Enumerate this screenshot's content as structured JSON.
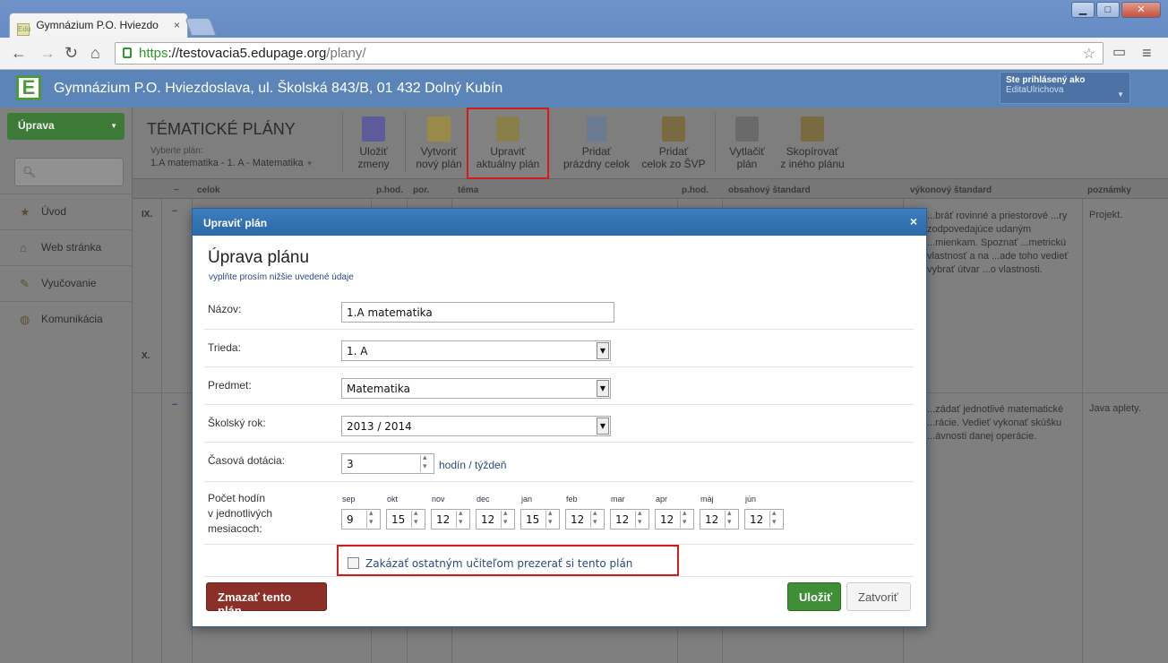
{
  "browser": {
    "tab_title": "Gymnázium P.O. Hviezdo",
    "tab_favicon": "Edu",
    "url_https": "https",
    "url_host": "://testovacia5.edupage.org",
    "url_path": "/plany/"
  },
  "header": {
    "school_name": "Gymnázium P.O. Hviezdoslava, ul. Školská 843/B, 01 432 Dolný Kubín",
    "login_title": "Ste prihlásený ako",
    "login_user": "EditaUlrichova"
  },
  "sidebar": {
    "menu_button": "Úprava",
    "items": [
      {
        "label": "Úvod",
        "icon": "star-icon"
      },
      {
        "label": "Web stránka",
        "icon": "home-icon"
      },
      {
        "label": "Vyučovanie",
        "icon": "book-icon"
      },
      {
        "label": "Komunikácia",
        "icon": "globe-icon"
      }
    ]
  },
  "topbar": {
    "title": "TÉMATICKÉ PLÁNY",
    "select_label": "Vyberte plán:",
    "select_value": "1.A matematika - 1. A - Matematika",
    "tools": [
      {
        "l1": "Uložiť",
        "l2": "zmeny"
      },
      {
        "l1": "Vytvoriť",
        "l2": "nový plán"
      },
      {
        "l1": "Upraviť",
        "l2": "aktuálny plán"
      },
      {
        "l1": "Pridať",
        "l2": "prázdny celok"
      },
      {
        "l1": "Pridať",
        "l2": "celok zo ŠVP"
      },
      {
        "l1": "Vytlačiť",
        "l2": "plán"
      },
      {
        "l1": "Skopírovať",
        "l2": "z iného plánu"
      }
    ]
  },
  "table": {
    "headers": {
      "minus": "−",
      "celok": "celok",
      "phod": "p.hod.",
      "por": "por.",
      "tema": "téma",
      "phod2": "p.hod.",
      "obsahovy": "obsahový štandard",
      "vykonovy": "výkonový štandard",
      "poznamky": "poznámky"
    },
    "row_ix": "IX.",
    "row_x": "X.",
    "vykon_1": "...bráť rovinné a priestorové ...ry zodpovedajúce udaným ...mienkam.  Spoznať ...metrickú vlastnosť a na ...ade toho vedieť vybrať útvar ...o vlastnosti.",
    "pozn_1": "Projekt.",
    "vykon_2": "...zádať jednotlivé matematické ...rácie. Vedieť vykonať skúšku ...ávnosti danej operácie.",
    "pozn_2": "Java aplety."
  },
  "modal": {
    "header": "Upraviť plán",
    "title": "Úprava plánu",
    "subtitle": "vyplňte prosím nižšie uvedené údaje",
    "fields": {
      "nazov_label": "Názov:",
      "nazov_value": "1.A matematika",
      "trieda_label": "Trieda:",
      "trieda_value": "1. A",
      "predmet_label": "Predmet:",
      "predmet_value": "Matematika",
      "rok_label": "Školský rok:",
      "rok_value": "2013 / 2014",
      "dotacia_label": "Časová dotácia:",
      "dotacia_value": "3",
      "dotacia_unit": "hodín / týždeň",
      "pocet_label_1": "Počet hodín",
      "pocet_label_2": "v jednotlivých",
      "pocet_label_3": "mesiacoch:"
    },
    "months": [
      {
        "name": "sep",
        "value": "9"
      },
      {
        "name": "okt",
        "value": "15"
      },
      {
        "name": "nov",
        "value": "12"
      },
      {
        "name": "dec",
        "value": "12"
      },
      {
        "name": "jan",
        "value": "15"
      },
      {
        "name": "feb",
        "value": "12"
      },
      {
        "name": "mar",
        "value": "12"
      },
      {
        "name": "apr",
        "value": "12"
      },
      {
        "name": "máj",
        "value": "12"
      },
      {
        "name": "jún",
        "value": "12"
      }
    ],
    "checkbox_label": "Zakázať ostatným učiteľom prezerať si tento plán",
    "delete_button": "Zmazať tento plán",
    "save_button": "Uložiť",
    "close_button": "Zatvoriť",
    "close_icon": "×"
  }
}
